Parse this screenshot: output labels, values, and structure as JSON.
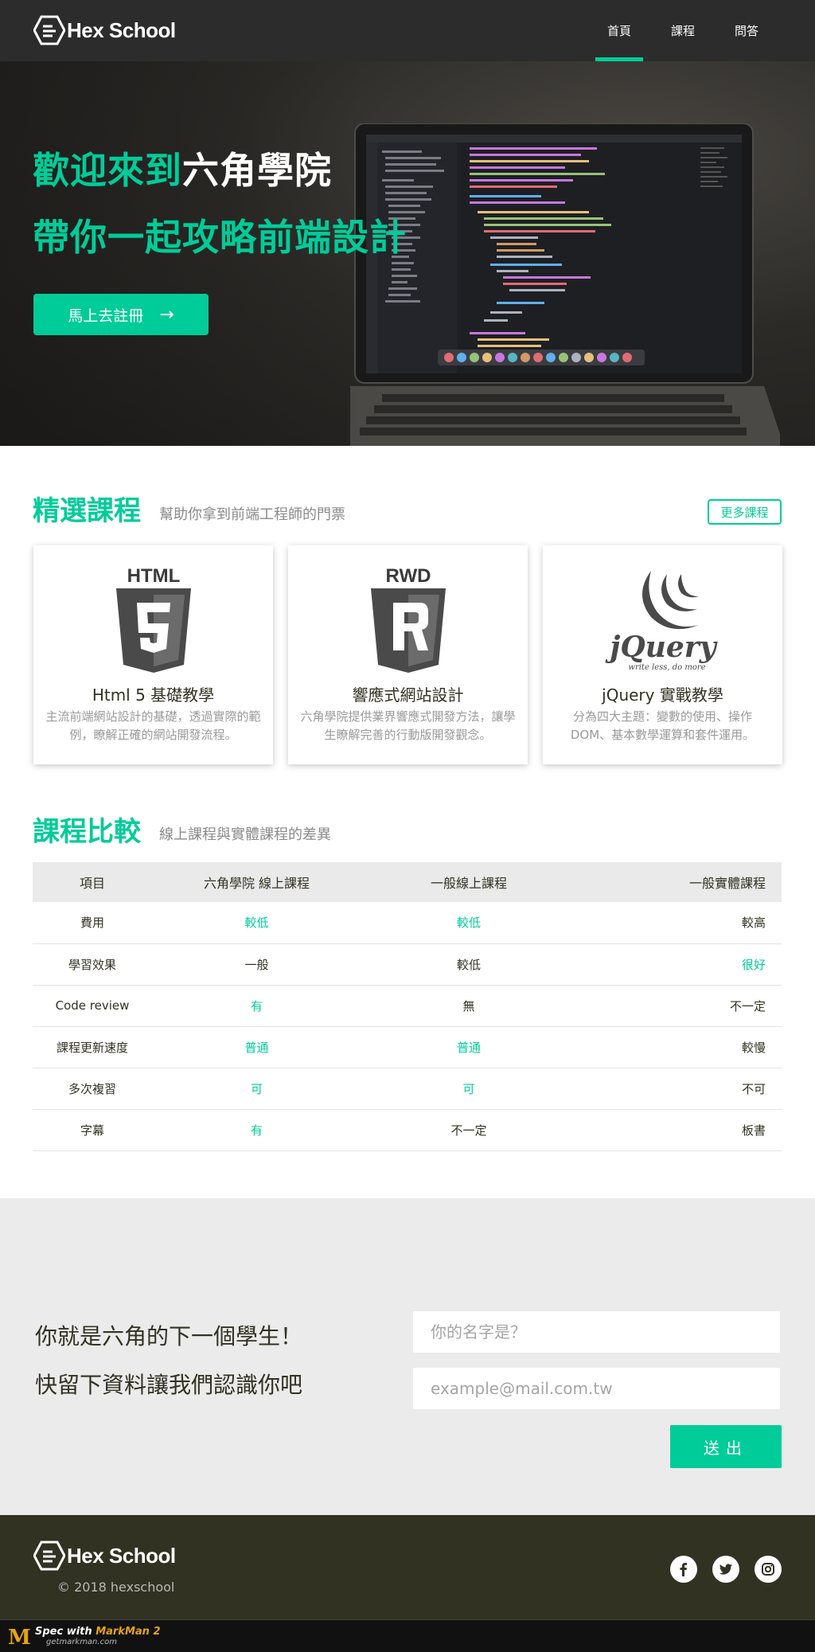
{
  "colors": {
    "accent": "#00cc99",
    "accent_soft": "#88e7cf",
    "text": "#323223",
    "footer_bg": "#323223"
  },
  "header": {
    "logo_text": "Hex School",
    "nav": [
      {
        "label": "首頁",
        "active": true
      },
      {
        "label": "課程",
        "active": false
      },
      {
        "label": "問答",
        "active": false
      }
    ]
  },
  "hero": {
    "line1_green": "歡迎來到",
    "line1_white": "六角學院",
    "line2": "帶你一起攻略前端設計",
    "cta_label": "馬上去註冊",
    "cta_icon": "arrow-right-icon"
  },
  "courses": {
    "title": "精選課程",
    "subtitle": "幫助你拿到前端工程師的門票",
    "more_label": "更多課程",
    "cards": [
      {
        "icon": "html5-icon",
        "icon_caption": "HTML",
        "title": "Html 5 基礎教學",
        "desc": "主流前端網站設計的基礎，透過實際的範例，瞭解正確的網站開發流程。"
      },
      {
        "icon": "rwd-icon",
        "icon_caption": "RWD",
        "title": "響應式網站設計",
        "desc": "六角學院提供業界響應式開發方法，讓學生瞭解完善的行動版開發觀念。"
      },
      {
        "icon": "jquery-icon",
        "icon_caption": "jQuery",
        "icon_tagline": "write less, do more",
        "title": "jQuery 實戰教學",
        "desc": "分為四大主題：變數的使用、操作 DOM、基本數學運算和套件運用。"
      }
    ]
  },
  "compare": {
    "title": "課程比較",
    "subtitle": "線上課程與實體課程的差異",
    "headers": [
      "項目",
      "六角學院 線上課程",
      "一般線上課程",
      "一般實體課程"
    ],
    "rows": [
      {
        "item": "費用",
        "values": [
          "較低",
          "較低",
          "較高"
        ],
        "highlight": [
          true,
          true,
          false
        ]
      },
      {
        "item": "學習效果",
        "values": [
          "一般",
          "較低",
          "很好"
        ],
        "highlight": [
          false,
          false,
          true
        ]
      },
      {
        "item": "Code review",
        "values": [
          "有",
          "無",
          "不一定"
        ],
        "highlight": [
          true,
          false,
          false
        ]
      },
      {
        "item": "課程更新速度",
        "values": [
          "普通",
          "普通",
          "較慢"
        ],
        "highlight": [
          true,
          true,
          false
        ]
      },
      {
        "item": "多次複習",
        "values": [
          "可",
          "可",
          "不可"
        ],
        "highlight": [
          true,
          true,
          false
        ]
      },
      {
        "item": "字幕",
        "values": [
          "有",
          "不一定",
          "板書"
        ],
        "highlight": [
          true,
          false,
          false
        ]
      }
    ]
  },
  "signup": {
    "line1": "你就是六角的下一個學生！",
    "line2": "快留下資料讓我們認識你吧",
    "name_placeholder": "你的名字是？",
    "email_placeholder": "example@mail.com.tw",
    "submit_label": "送出"
  },
  "footer": {
    "logo_text": "Hex School",
    "copyright": "© 2018 hexschool",
    "social": [
      "facebook-icon",
      "twitter-icon",
      "instagram-icon"
    ]
  },
  "watermark": {
    "prefix": "Spec with ",
    "brand": "MarkMan 2",
    "url": "getmarkman.com"
  }
}
